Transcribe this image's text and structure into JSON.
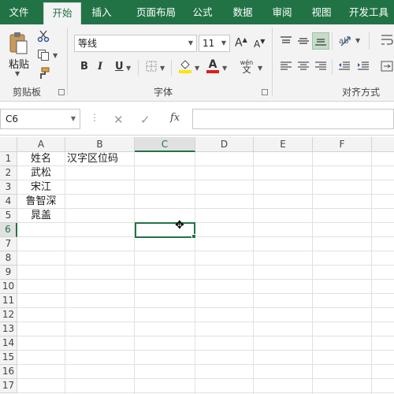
{
  "tabs": [
    "文件",
    "开始",
    "插入",
    "页面布局",
    "公式",
    "数据",
    "审阅",
    "视图",
    "开发工具"
  ],
  "active_tab": "开始",
  "ribbon": {
    "clipboard": {
      "paste_label": "粘贴",
      "group_label": "剪贴板"
    },
    "font": {
      "font_name": "等线",
      "font_size": "11",
      "group_label": "字体",
      "bold": "B",
      "italic": "I",
      "underline": "U",
      "grow": "A",
      "shrink": "A",
      "phonetic": "wén"
    },
    "alignment": {
      "group_label": "对齐方式"
    }
  },
  "formula_bar": {
    "name_box": "C6",
    "fx_label": "fx",
    "formula": ""
  },
  "sheet": {
    "columns": [
      "A",
      "B",
      "C",
      "D",
      "E",
      "F"
    ],
    "selected_column": "C",
    "rows": [
      "1",
      "2",
      "3",
      "4",
      "5",
      "6",
      "7",
      "8",
      "9",
      "10",
      "11",
      "12",
      "13",
      "14",
      "15",
      "16",
      "17"
    ],
    "selected_row": "6",
    "cells": {
      "A1": "姓名",
      "B1": "汉字区位码",
      "A2": "武松",
      "A3": "宋江",
      "A4": "鲁智深",
      "A5": "晁盖"
    }
  },
  "colors": {
    "accent": "#217346",
    "ribbon_bg": "#f3f3f3",
    "font_color": "#e01b1b",
    "fill_color": "#ffe400"
  }
}
